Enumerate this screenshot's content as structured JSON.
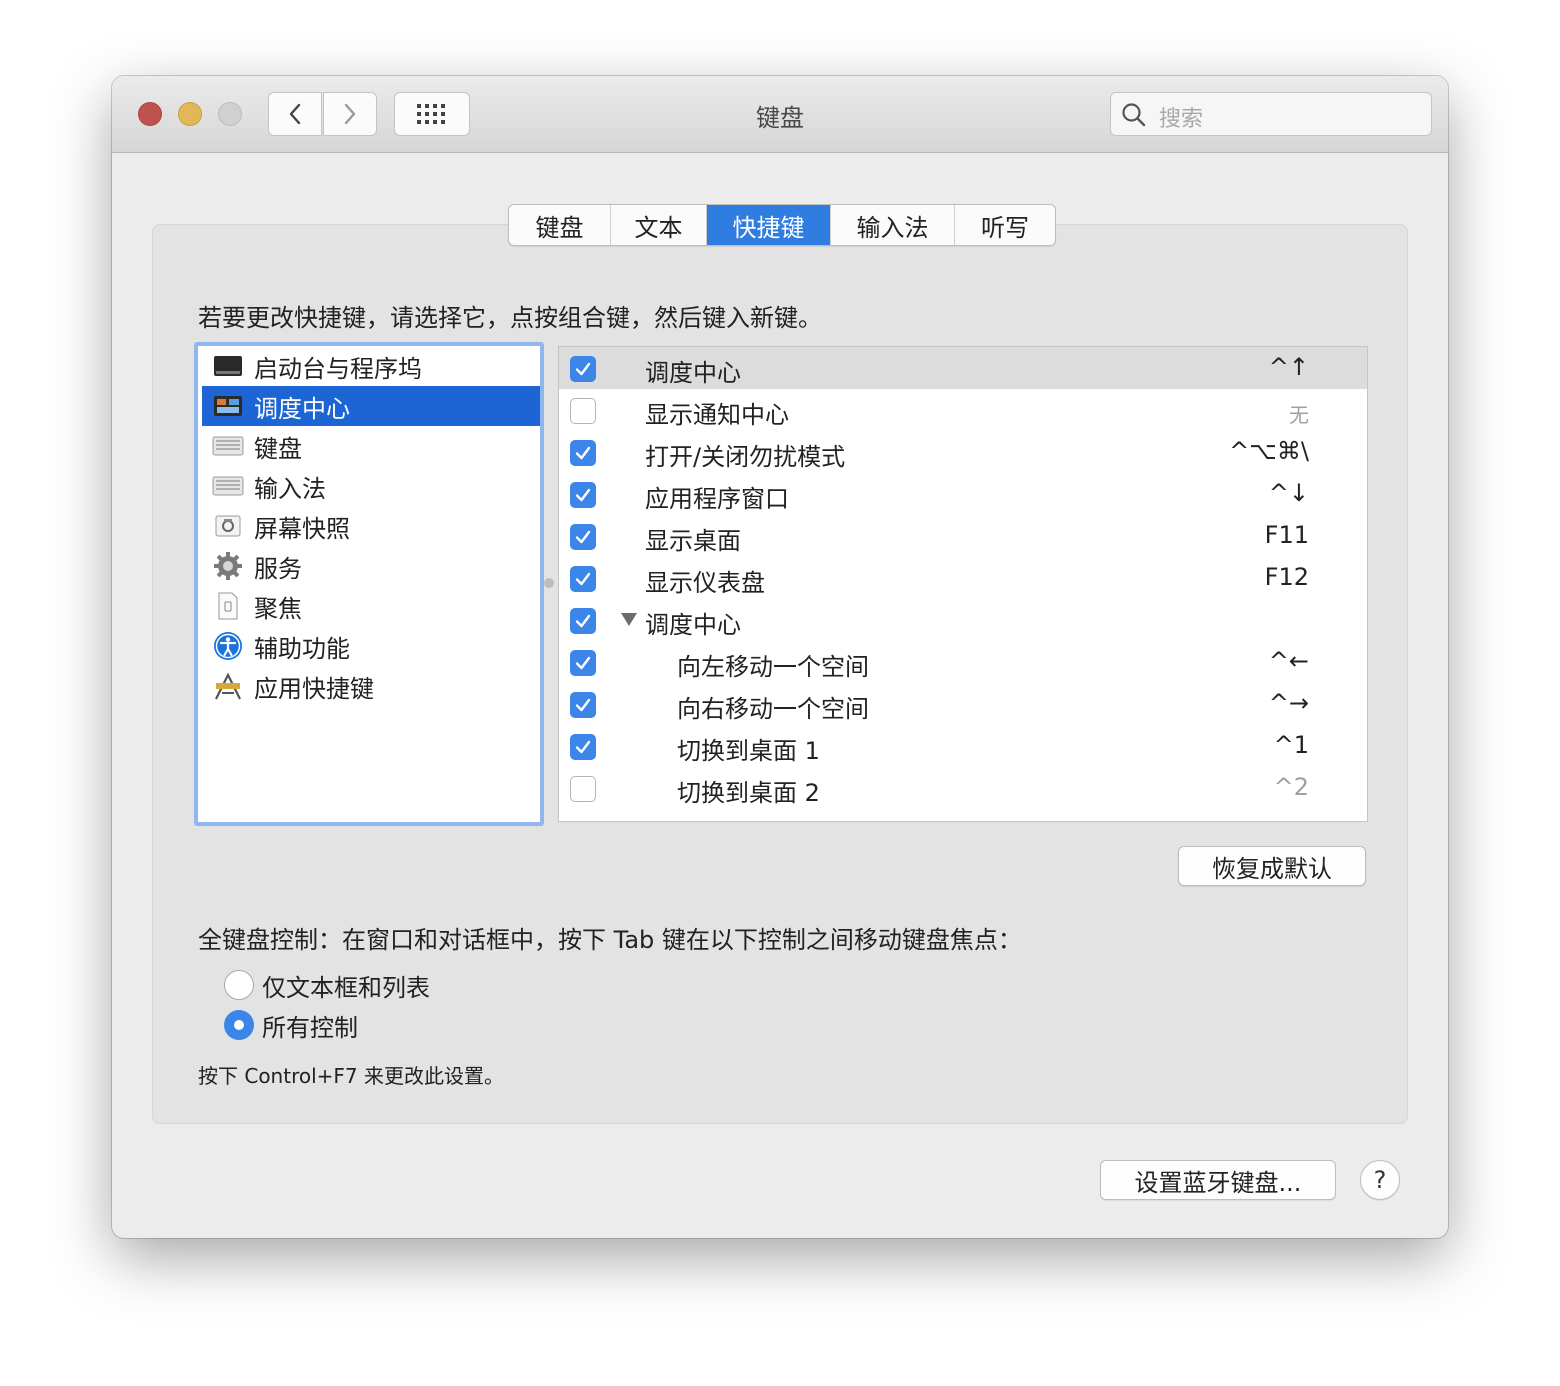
{
  "window": {
    "title": "键盘",
    "search_placeholder": "搜索"
  },
  "tabs": [
    {
      "label": "键盘",
      "active": false
    },
    {
      "label": "文本",
      "active": false
    },
    {
      "label": "快捷键",
      "active": true
    },
    {
      "label": "输入法",
      "active": false
    },
    {
      "label": "听写",
      "active": false
    }
  ],
  "instructions": "若要更改快捷键，请选择它，点按组合键，然后键入新键。",
  "categories": [
    {
      "label": "启动台与程序坞",
      "icon": "launchpad-icon",
      "selected": false
    },
    {
      "label": "调度中心",
      "icon": "mission-control-icon",
      "selected": true
    },
    {
      "label": "键盘",
      "icon": "keyboard-icon",
      "selected": false
    },
    {
      "label": "输入法",
      "icon": "input-method-icon",
      "selected": false
    },
    {
      "label": "屏幕快照",
      "icon": "screenshot-icon",
      "selected": false
    },
    {
      "label": "服务",
      "icon": "gear-icon",
      "selected": false
    },
    {
      "label": "聚焦",
      "icon": "spotlight-icon",
      "selected": false
    },
    {
      "label": "辅助功能",
      "icon": "accessibility-icon",
      "selected": false
    },
    {
      "label": "应用快捷键",
      "icon": "app-shortcuts-icon",
      "selected": false
    }
  ],
  "shortcuts": [
    {
      "label": "调度中心",
      "key": "^↑",
      "checked": true,
      "indent": 0,
      "highlight": true
    },
    {
      "label": "显示通知中心",
      "key": "无",
      "checked": false,
      "indent": 0,
      "dim": true,
      "small": true
    },
    {
      "label": "打开/关闭勿扰模式",
      "key": "^⌥⌘\\",
      "checked": true,
      "indent": 0
    },
    {
      "label": "应用程序窗口",
      "key": "^↓",
      "checked": true,
      "indent": 0
    },
    {
      "label": "显示桌面",
      "key": "F11",
      "checked": true,
      "indent": 0
    },
    {
      "label": "显示仪表盘",
      "key": "F12",
      "checked": true,
      "indent": 0
    },
    {
      "label": "调度中心",
      "key": "",
      "checked": true,
      "indent": 0,
      "group": true
    },
    {
      "label": "向左移动一个空间",
      "key": "^←",
      "checked": true,
      "indent": 1
    },
    {
      "label": "向右移动一个空间",
      "key": "^→",
      "checked": true,
      "indent": 1
    },
    {
      "label": "切换到桌面 1",
      "key": "^1",
      "checked": true,
      "indent": 1
    },
    {
      "label": "切换到桌面 2",
      "key": "^2",
      "checked": false,
      "indent": 1,
      "dim": true
    }
  ],
  "restore_button": "恢复成默认",
  "full_keyboard_control": {
    "label": "全键盘控制：在窗口和对话框中，按下 Tab 键在以下控制之间移动键盘焦点：",
    "options": [
      {
        "label": "仅文本框和列表",
        "selected": false
      },
      {
        "label": "所有控制",
        "selected": true
      }
    ],
    "hint": "按下 Control+F7 来更改此设置。"
  },
  "bluetooth_button": "设置蓝牙键盘...",
  "help_button": "?",
  "colors": {
    "accent": "#3b86e8",
    "selection": "#1d65d4",
    "tab_active": "#2f7de1"
  }
}
